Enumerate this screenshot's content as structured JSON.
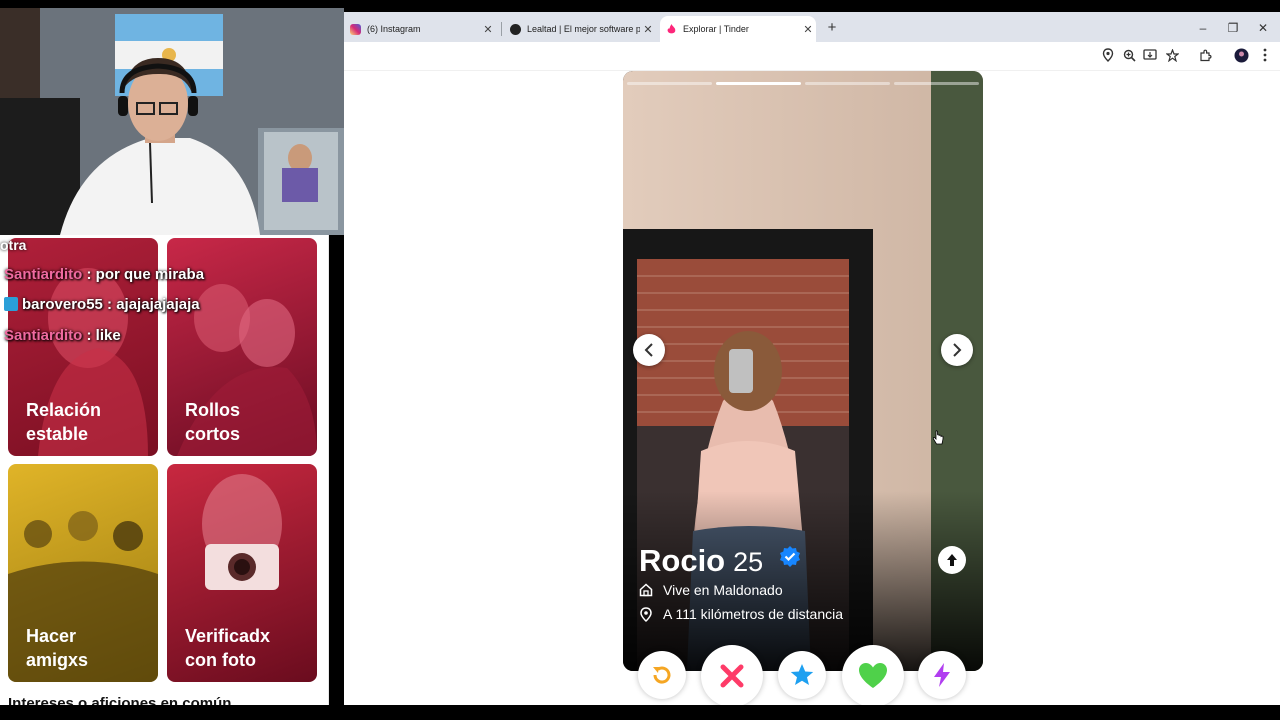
{
  "browser": {
    "tabs": [
      {
        "title": "(6) Instagram",
        "favicon_color": "#d6249f",
        "active": false
      },
      {
        "title": "Lealtad | El mejor software para",
        "favicon_color": "#222222",
        "active": false
      },
      {
        "title": "Explorar | Tinder",
        "favicon_color": "#fd267a",
        "active": true
      }
    ],
    "new_tab": "+",
    "window_controls": {
      "minimize": "–",
      "restore": "❐",
      "close": "✕"
    }
  },
  "chat": {
    "fragment": "otra",
    "messages": [
      {
        "user": "Santiardito",
        "text": ": por que miraba"
      },
      {
        "user": "barovero55",
        "text": ": ajajajajajaja"
      },
      {
        "user": "Santiardito",
        "text": ": like"
      }
    ]
  },
  "categories": [
    {
      "label": "Relación estable"
    },
    {
      "label": "Rollos cortos"
    },
    {
      "label": "Hacer amigxs"
    },
    {
      "label": "Verificadx con foto"
    }
  ],
  "interests_heading": "Intereses o aficiones en común",
  "profile": {
    "name": "Rocio",
    "age": "25",
    "lives_in": "Vive en Maldonado",
    "distance": "A 111 kilómetros de distancia",
    "photo_count": 4,
    "current_photo": 2
  },
  "colors": {
    "tinder_brand": "#fd267a",
    "rewind": "#f5a623",
    "nope": "#fe3b68",
    "super_like": "#1ea0f0",
    "like": "#4fd14a",
    "boost": "#b13ef0",
    "verified": "#1786ff"
  },
  "icons": [
    "location-icon",
    "zoom-icon",
    "install-icon",
    "bookmark-star-icon",
    "extensions-icon",
    "profile-avatar-icon",
    "menu-icon"
  ]
}
